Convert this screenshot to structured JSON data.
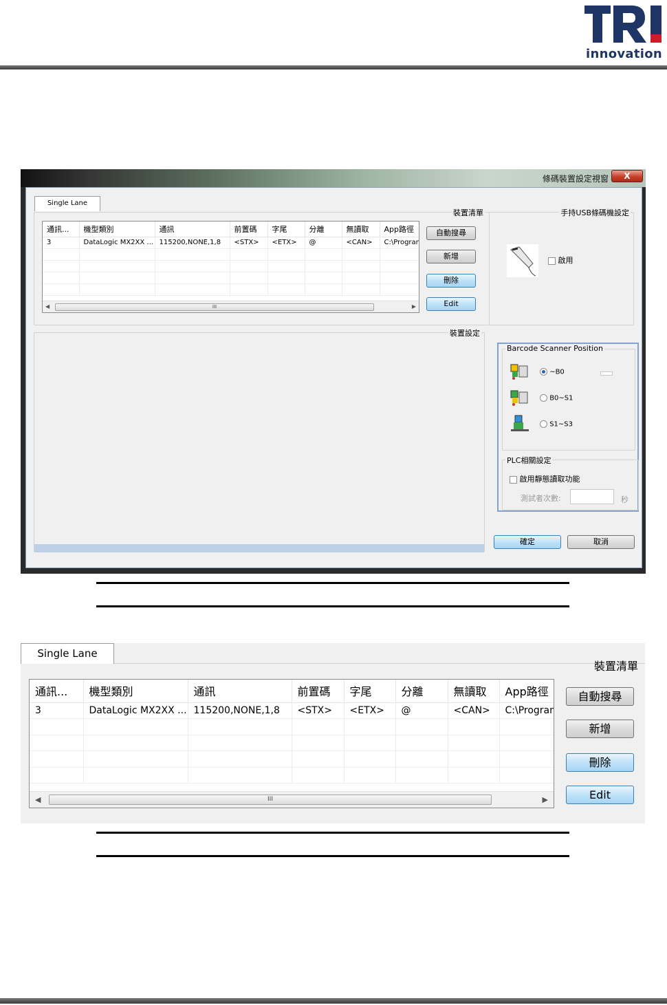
{
  "logo": {
    "text": "innovation"
  },
  "dialog": {
    "title": "條碼裝置設定視窗",
    "close_label": "X",
    "tab_label": "Single Lane",
    "device_list_title": "裝置清單",
    "device_settings_title": "裝置設定",
    "usb_group_title": "手持USB條碼機設定",
    "usb_enable_label": "啟用",
    "table": {
      "columns": [
        "通訊...",
        "機型類別",
        "通訊",
        "前置碼",
        "字尾",
        "分離",
        "無讀取",
        "App路徑"
      ],
      "rows": [
        [
          "3",
          "DataLogic MX2XX ...",
          "115200,NONE,1,8",
          "<STX>",
          "<ETX>",
          "@",
          "<CAN>",
          "C:\\Progran"
        ]
      ],
      "empty_rows": 4,
      "scroll_grip": "III"
    },
    "buttons": {
      "auto_search": "自動搜尋",
      "add": "新增",
      "delete": "刪除",
      "edit": "Edit",
      "ok": "確定",
      "cancel": "取消"
    },
    "position": {
      "title": "Barcode Scanner Position",
      "options": [
        {
          "label": "~B0",
          "selected": true
        },
        {
          "label": "B0~S1",
          "selected": false
        },
        {
          "label": "S1~S3",
          "selected": false
        }
      ]
    },
    "plc": {
      "title": "PLC相關設定",
      "enable_label": "啟用靜態讀取功能",
      "retry_label": "測試者次數:",
      "retry_unit": "秒"
    }
  },
  "zoom": {
    "tab_label": "Single Lane",
    "device_list_title": "裝置清單",
    "table": {
      "columns": [
        "通訊...",
        "機型類別",
        "通訊",
        "前置碼",
        "字尾",
        "分離",
        "無讀取",
        "App路徑"
      ],
      "rows": [
        [
          "3",
          "DataLogic MX2XX ...",
          "115200,NONE,1,8",
          "<STX>",
          "<ETX>",
          "@",
          "<CAN>",
          "C:\\Progran"
        ]
      ],
      "empty_rows": 4,
      "scroll_grip": "III"
    },
    "buttons": {
      "auto_search": "自動搜尋",
      "add": "新增",
      "delete": "刪除",
      "edit": "Edit"
    }
  },
  "colors": {
    "brand_navy": "#1f3566",
    "brand_red": "#c8202a",
    "selection_blue": "#7ea4cf"
  }
}
